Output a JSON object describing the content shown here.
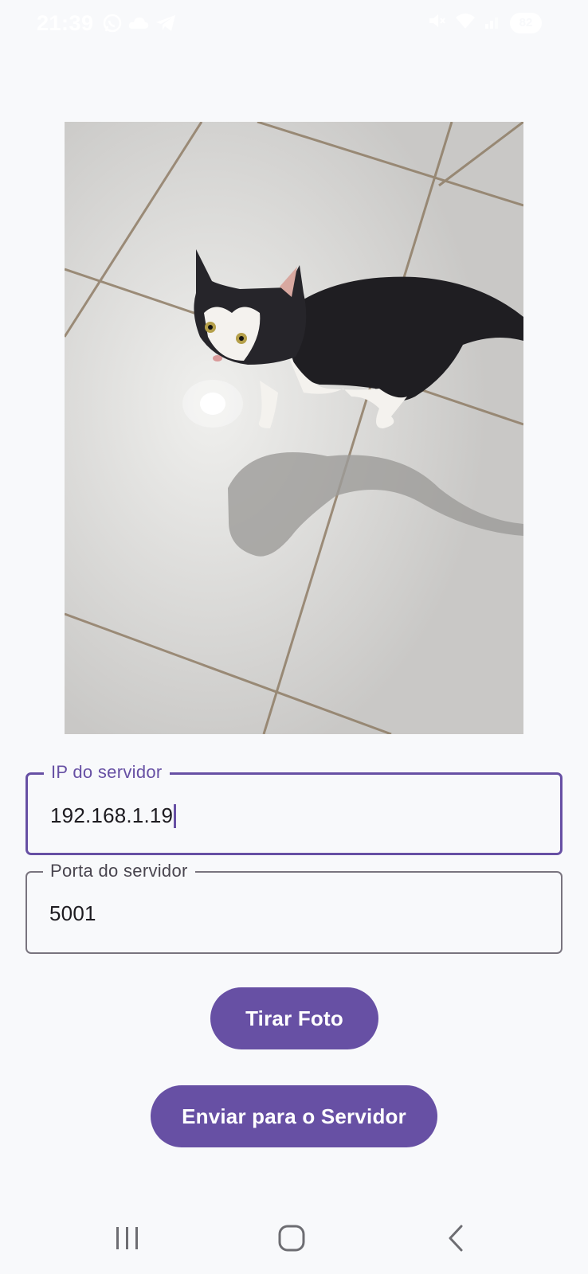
{
  "status_bar": {
    "time": "21:39",
    "battery": "82",
    "icons": [
      "whatsapp-icon",
      "cloud-icon",
      "telegram-icon",
      "mute-icon",
      "wifi-icon",
      "signal-icon",
      "battery-icon"
    ]
  },
  "photo": {
    "icon": "photo-icon"
  },
  "ip_field": {
    "label": "IP do servidor",
    "value": "192.168.1.19"
  },
  "port_field": {
    "label": "Porta do servidor",
    "value": "5001"
  },
  "buttons": {
    "take_photo": "Tirar Foto",
    "send_to_server": "Enviar para o Servidor"
  },
  "nav_bar": {
    "items": [
      "recent-apps-icon",
      "home-icon",
      "back-icon"
    ]
  },
  "colors": {
    "accent": "#6750a4",
    "background": "#f8f9fb",
    "outline": "#79747e"
  }
}
